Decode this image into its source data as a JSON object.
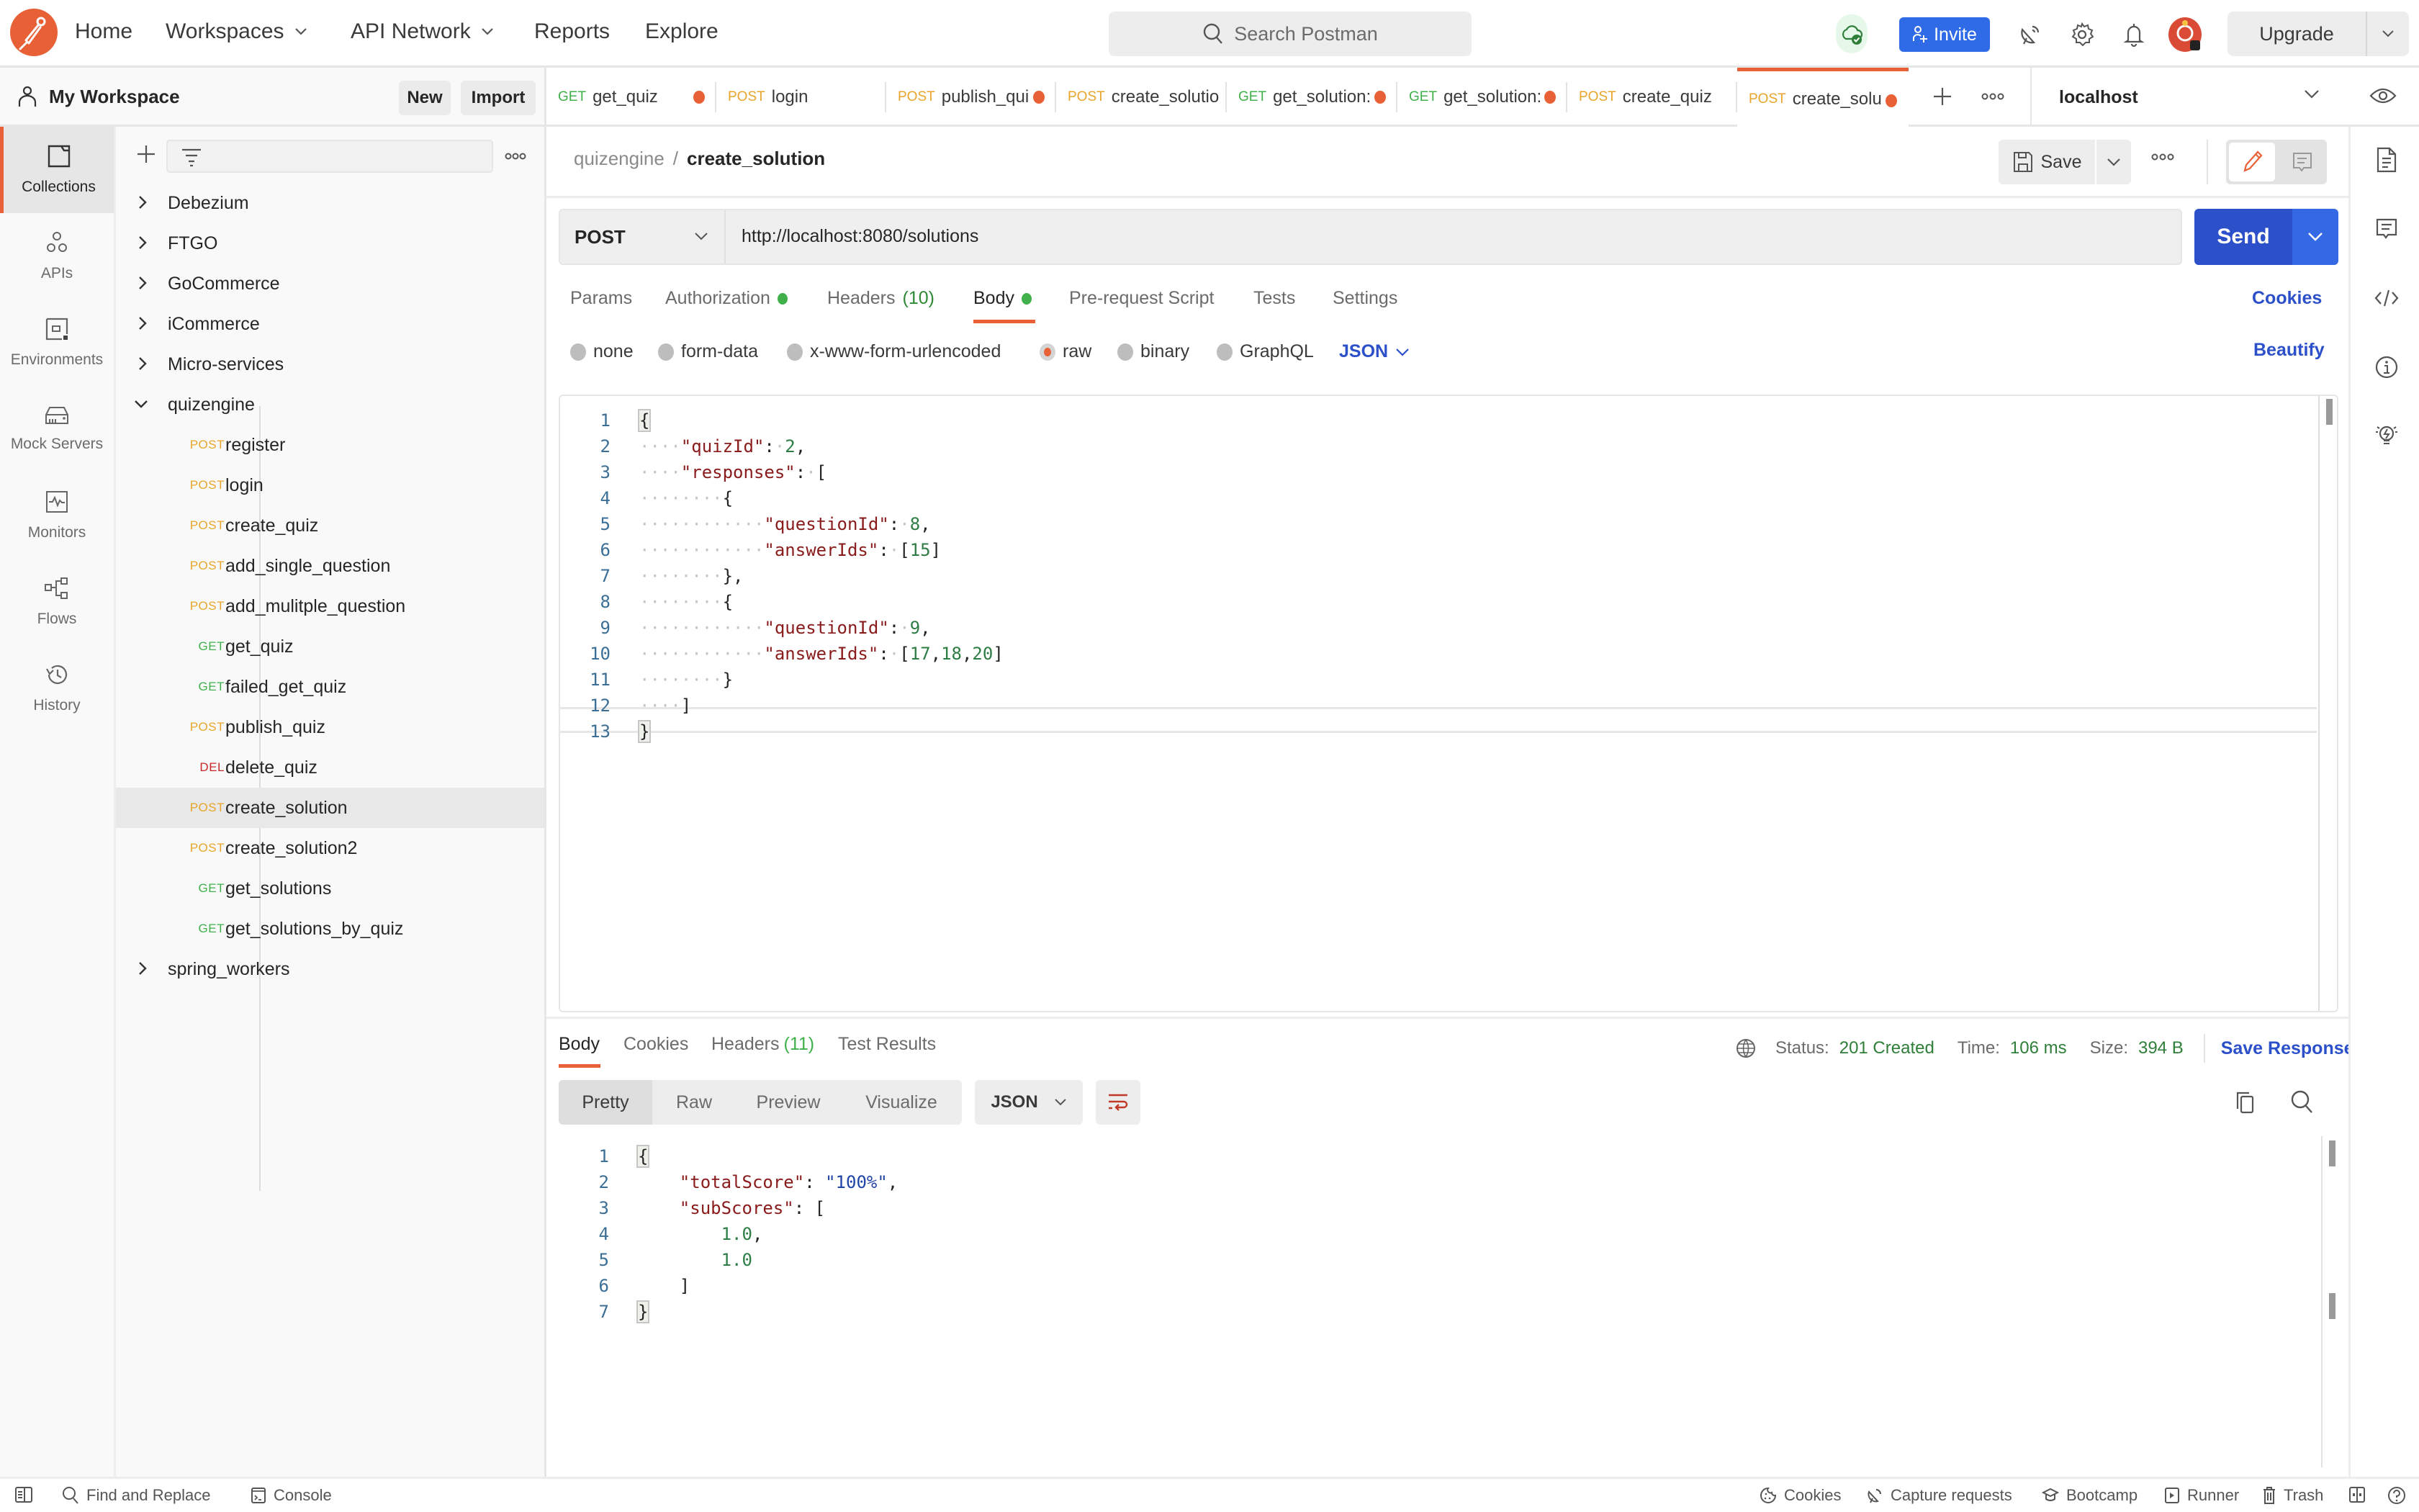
{
  "topbar": {
    "nav": [
      {
        "label": "Home",
        "dropdown": false
      },
      {
        "label": "Workspaces",
        "dropdown": true
      },
      {
        "label": "API Network",
        "dropdown": true
      },
      {
        "label": "Reports",
        "dropdown": false
      },
      {
        "label": "Explore",
        "dropdown": false
      }
    ],
    "search_placeholder": "Search Postman",
    "invite_label": "Invite",
    "upgrade_label": "Upgrade"
  },
  "workspace": {
    "title": "My Workspace",
    "new_label": "New",
    "import_label": "Import"
  },
  "tabs": [
    {
      "method": "GET",
      "name": "get_quiz",
      "unsaved": true,
      "active": false
    },
    {
      "method": "POST",
      "name": "login",
      "unsaved": false,
      "active": false
    },
    {
      "method": "POST",
      "name": "publish_qui",
      "unsaved": true,
      "active": false
    },
    {
      "method": "POST",
      "name": "create_solutio",
      "unsaved": false,
      "active": false
    },
    {
      "method": "GET",
      "name": "get_solution:",
      "unsaved": true,
      "active": false
    },
    {
      "method": "GET",
      "name": "get_solution:",
      "unsaved": true,
      "active": false
    },
    {
      "method": "POST",
      "name": "create_quiz",
      "unsaved": false,
      "active": false
    },
    {
      "method": "POST",
      "name": "create_solu",
      "unsaved": true,
      "active": true
    }
  ],
  "environment": "localhost",
  "rail": [
    {
      "label": "Collections",
      "icon": "collections-icon",
      "active": true
    },
    {
      "label": "APIs",
      "icon": "apis-icon",
      "active": false
    },
    {
      "label": "Environments",
      "icon": "environments-icon",
      "active": false
    },
    {
      "label": "Mock Servers",
      "icon": "mock-servers-icon",
      "active": false
    },
    {
      "label": "Monitors",
      "icon": "monitors-icon",
      "active": false
    },
    {
      "label": "Flows",
      "icon": "flows-icon",
      "active": false
    },
    {
      "label": "History",
      "icon": "history-icon",
      "active": false
    }
  ],
  "collections": [
    {
      "name": "Debezium",
      "expanded": false
    },
    {
      "name": "FTGO",
      "expanded": false
    },
    {
      "name": "GoCommerce",
      "expanded": false
    },
    {
      "name": "iCommerce",
      "expanded": false
    },
    {
      "name": "Micro-services",
      "expanded": false
    },
    {
      "name": "quizengine",
      "expanded": true,
      "requests": [
        {
          "method": "POST",
          "name": "register"
        },
        {
          "method": "POST",
          "name": "login"
        },
        {
          "method": "POST",
          "name": "create_quiz"
        },
        {
          "method": "POST",
          "name": "add_single_question"
        },
        {
          "method": "POST",
          "name": "add_mulitple_question"
        },
        {
          "method": "GET",
          "name": "get_quiz"
        },
        {
          "method": "GET",
          "name": "failed_get_quiz"
        },
        {
          "method": "POST",
          "name": "publish_quiz"
        },
        {
          "method": "DEL",
          "name": "delete_quiz"
        },
        {
          "method": "POST",
          "name": "create_solution",
          "selected": true
        },
        {
          "method": "POST",
          "name": "create_solution2"
        },
        {
          "method": "GET",
          "name": "get_solutions"
        },
        {
          "method": "GET",
          "name": "get_solutions_by_quiz"
        }
      ]
    },
    {
      "name": "spring_workers",
      "expanded": false
    }
  ],
  "method_colors": {
    "GET": "#3fb04a",
    "POST": "#e9a52b",
    "DEL": "#c62828"
  },
  "request": {
    "breadcrumb_parent": "quizengine",
    "breadcrumb_current": "create_solution",
    "save_label": "Save",
    "method": "POST",
    "url": "http://localhost:8080/solutions",
    "send_label": "Send",
    "tabs": [
      {
        "label": "Params"
      },
      {
        "label": "Authorization",
        "dot": true
      },
      {
        "label": "Headers",
        "count": "(10)"
      },
      {
        "label": "Body",
        "dot": true,
        "active": true
      },
      {
        "label": "Pre-request Script"
      },
      {
        "label": "Tests"
      },
      {
        "label": "Settings"
      }
    ],
    "cookies_label": "Cookies",
    "body_types": [
      "none",
      "form-data",
      "x-www-form-urlencoded",
      "raw",
      "binary",
      "GraphQL"
    ],
    "body_type_selected": "raw",
    "body_format": "JSON",
    "beautify_label": "Beautify",
    "body_lines": [
      "{",
      "    \"quizId\": 2,",
      "    \"responses\": [",
      "        {",
      "            \"questionId\": 8,",
      "            \"answerIds\": [15]",
      "        },",
      "        {",
      "            \"questionId\": 9,",
      "            \"answerIds\": [17,18,20]",
      "        }",
      "    ]",
      "}"
    ]
  },
  "response": {
    "tabs": [
      {
        "label": "Body",
        "active": true
      },
      {
        "label": "Cookies"
      },
      {
        "label": "Headers",
        "count": "(11)"
      },
      {
        "label": "Test Results"
      }
    ],
    "status_label": "Status:",
    "status": "201 Created",
    "time_label": "Time:",
    "time": "106 ms",
    "size_label": "Size:",
    "size": "394 B",
    "save_response_label": "Save Response",
    "views": [
      "Pretty",
      "Raw",
      "Preview",
      "Visualize"
    ],
    "view_selected": "Pretty",
    "format": "JSON",
    "body_lines": [
      "{",
      "    \"totalScore\": \"100%\",",
      "    \"subScores\": [",
      "        1.0,",
      "        1.0",
      "    ]",
      "}"
    ]
  },
  "statusbar": {
    "left": [
      {
        "label": "",
        "icon": "sidebar-toggle-icon"
      },
      {
        "label": "Find and Replace",
        "icon": "search-icon"
      },
      {
        "label": "Console",
        "icon": "console-icon"
      }
    ],
    "right": [
      {
        "label": "Cookies",
        "icon": "cookie-icon"
      },
      {
        "label": "Capture requests",
        "icon": "satellite-icon"
      },
      {
        "label": "Bootcamp",
        "icon": "bootcamp-icon"
      },
      {
        "label": "Runner",
        "icon": "runner-icon"
      },
      {
        "label": "Trash",
        "icon": "trash-icon"
      }
    ]
  }
}
